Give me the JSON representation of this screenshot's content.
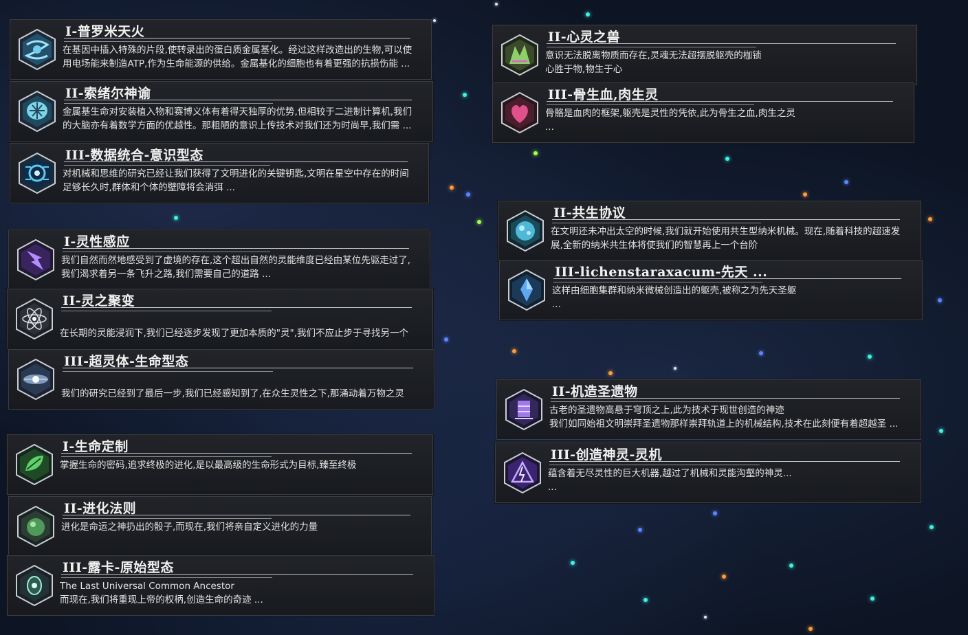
{
  "cards": [
    {
      "title": "I-普罗米天火",
      "desc": "在基因中插入特殊的片段,使转录出的蛋白质金属基化。经过这样改造出的生物,可以使\n用电场能来制造ATP,作为生命能源的供给。金属基化的细胞也有着更强的抗损伤能 ...",
      "icon": "metal-gene-icon"
    },
    {
      "title": "II-索绪尔神谕",
      "desc": "金属基生命对安装植入物和赛博义体有着得天独厚的优势,但相较于二进制计算机,我们\n的大脑亦有着数学方面的优越性。那粗陋的意识上传技术对我们还为时尚早,我们需 ...",
      "icon": "cyber-brain-icon"
    },
    {
      "title": "III-数据统合-意识型态",
      "desc": "对机械和思维的研究已经让我们获得了文明进化的关键钥匙,文明在星空中存在的时间\n足够长久时,群体和个体的壁障将会消弭 ...",
      "icon": "data-circuit-icon"
    },
    {
      "title": "I-灵性感应",
      "desc": "我们自然而然地感受到了虚境的存在,这个超出自然的灵能维度已经由某位先驱走过了,\n我们渴求着另一条飞升之路,我们需要自己的道路 ...",
      "icon": "psionic-lightning-icon"
    },
    {
      "title": "II-灵之聚变",
      "desc": "\n在长期的灵能浸润下,我们已经逐步发现了更加本质的\"灵\",我们不应止步于寻找另一个",
      "icon": "atom-orbit-icon"
    },
    {
      "title": "III-超灵体-生命型态",
      "desc": "\n我们的研究已经到了最后一步,我们已经感知到了,在众生灵性之下,那涌动着万物之灵",
      "icon": "psionic-being-icon"
    },
    {
      "title": "I-生命定制",
      "desc": "掌握生命的密码,追求终极的进化,是以最高级的生命形式为目标,臻至终极",
      "icon": "green-leaf-icon"
    },
    {
      "title": "II-进化法则",
      "desc": "进化是命运之神扔出的骰子,而现在,我们将亲自定义进化的力量",
      "icon": "green-orb-icon"
    },
    {
      "title": "III-露卡-原始型态",
      "desc": "The Last Universal Common Ancestor\n而现在,我们将重现上帝的权柄,创造生命的奇迹 ...",
      "icon": "primordial-cell-icon"
    },
    {
      "title": "II-心灵之兽",
      "desc": "意识无法脱离物质而存在,灵魂无法超摆脱躯壳的枷锁\n心胜于物,物生于心",
      "icon": "dragon-beast-icon"
    },
    {
      "title": "III-骨生血,肉生灵",
      "desc": "骨骼是血肉的框架,躯壳是灵性的凭依,此为骨生之血,肉生之灵\n...",
      "icon": "flesh-heart-icon"
    },
    {
      "title": "II-共生协议",
      "desc": "在文明还未冲出太空的时候,我们就开始使用共生型纳米机械。现在,随着科技的超速发\n展,全新的纳米共生体将使我们的智慧再上一个台阶",
      "icon": "nano-symbiote-icon"
    },
    {
      "title": "III-lichenstaraxacum-先天 ...",
      "desc": "这样由细胞集群和纳米微械创造出的躯壳,被称之为先天圣躯\n...",
      "icon": "blue-crystal-icon"
    },
    {
      "title": "II-机造圣遗物",
      "desc": "古老的圣遗物高悬于穹顶之上,此为技术于现世创造的神迹\n我们如同始祖文明崇拜圣遗物那样崇拜轨道上的机械结构,技术在此刻便有着超越圣 ...",
      "icon": "relic-machine-icon"
    },
    {
      "title": "III-创造神灵-灵机",
      "desc": "蕴含着无尽灵性的巨大机器,越过了机械和灵能沟壑的神灵...\n...",
      "icon": "psi-machine-icon"
    }
  ],
  "colors": {
    "cyan_star": "#3ff2e0",
    "blue_star": "#5a86ff",
    "orange_star": "#ff9a3c"
  }
}
